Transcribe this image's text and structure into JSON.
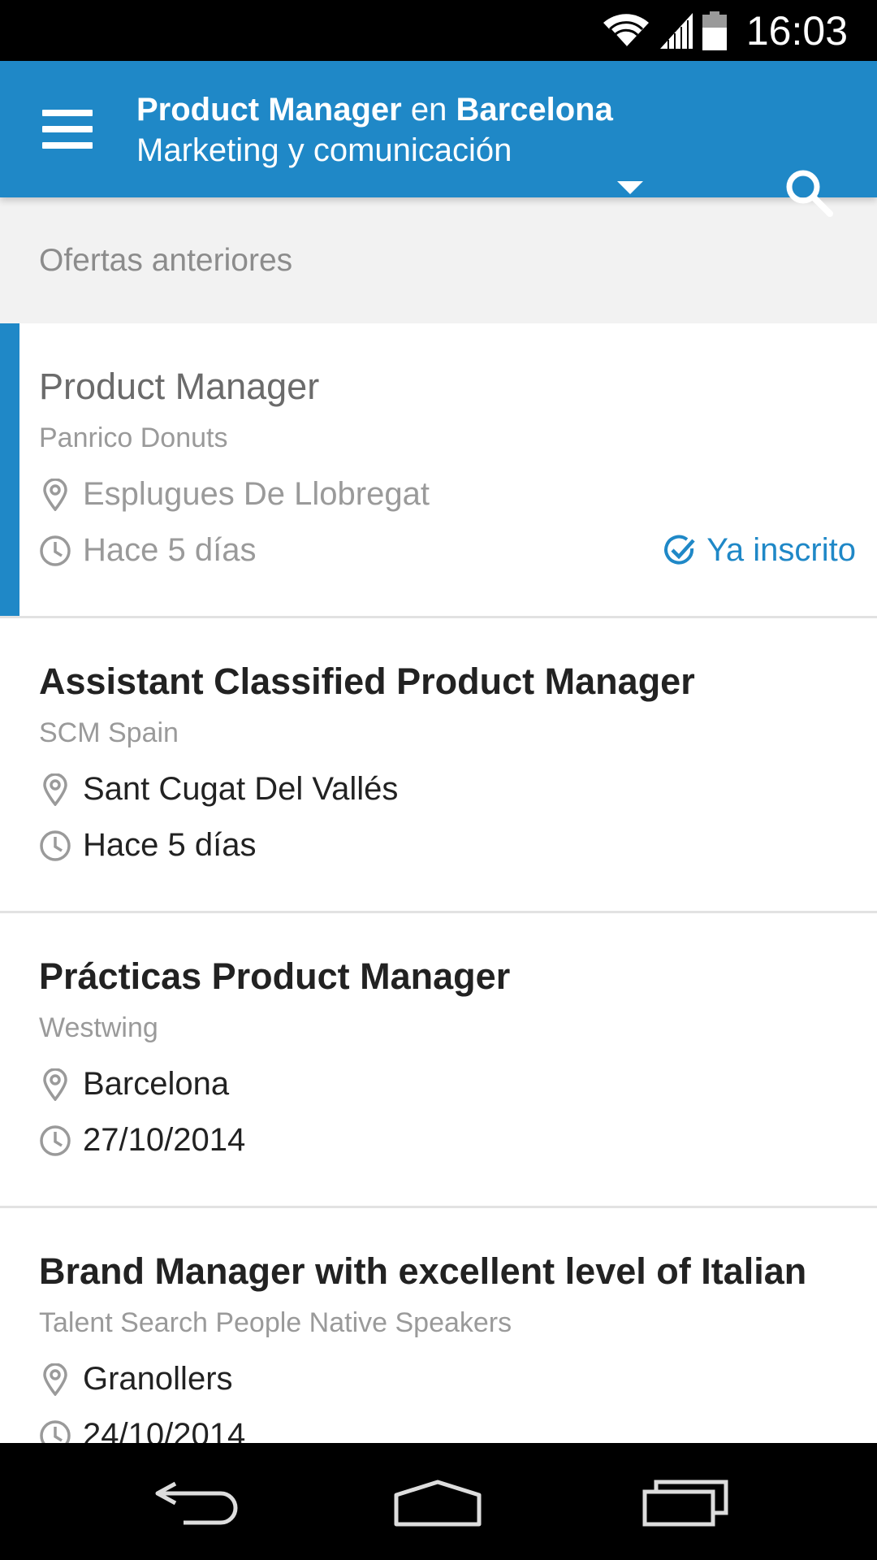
{
  "status_bar": {
    "time": "16:03",
    "icons": [
      "wifi-icon",
      "cell-signal-icon",
      "battery-icon"
    ]
  },
  "app_bar": {
    "menu_icon": "hamburger-menu-icon",
    "title_role": "Product Manager",
    "title_connector": " en ",
    "title_city": "Barcelona",
    "subtitle": "Marketing y comunicación",
    "dropdown_icon": "dropdown-arrow-icon",
    "search_icon": "search-icon",
    "background_color": "#1f88c7"
  },
  "section": {
    "label": "Ofertas anteriores"
  },
  "jobs": [
    {
      "title": "Product Manager",
      "company": "Panrico Donuts",
      "location": "Esplugues De Llobregat",
      "posted": "Hace 5 días",
      "applied_label": "Ya inscrito"
    },
    {
      "title": "Assistant Classified Product Manager",
      "company": "SCM Spain",
      "location": "Sant Cugat Del Vallés",
      "posted": "Hace 5 días"
    },
    {
      "title": "Prácticas Product Manager",
      "company": "Westwing",
      "location": "Barcelona",
      "posted": "27/10/2014"
    },
    {
      "title": "Brand Manager with excellent level of Italian",
      "company": "Talent Search People  Native Speakers",
      "location": "Granollers",
      "posted": "24/10/2014"
    }
  ],
  "nav_bar": {
    "back_icon": "back-icon",
    "home_icon": "home-icon",
    "recent_icon": "recent-apps-icon"
  }
}
